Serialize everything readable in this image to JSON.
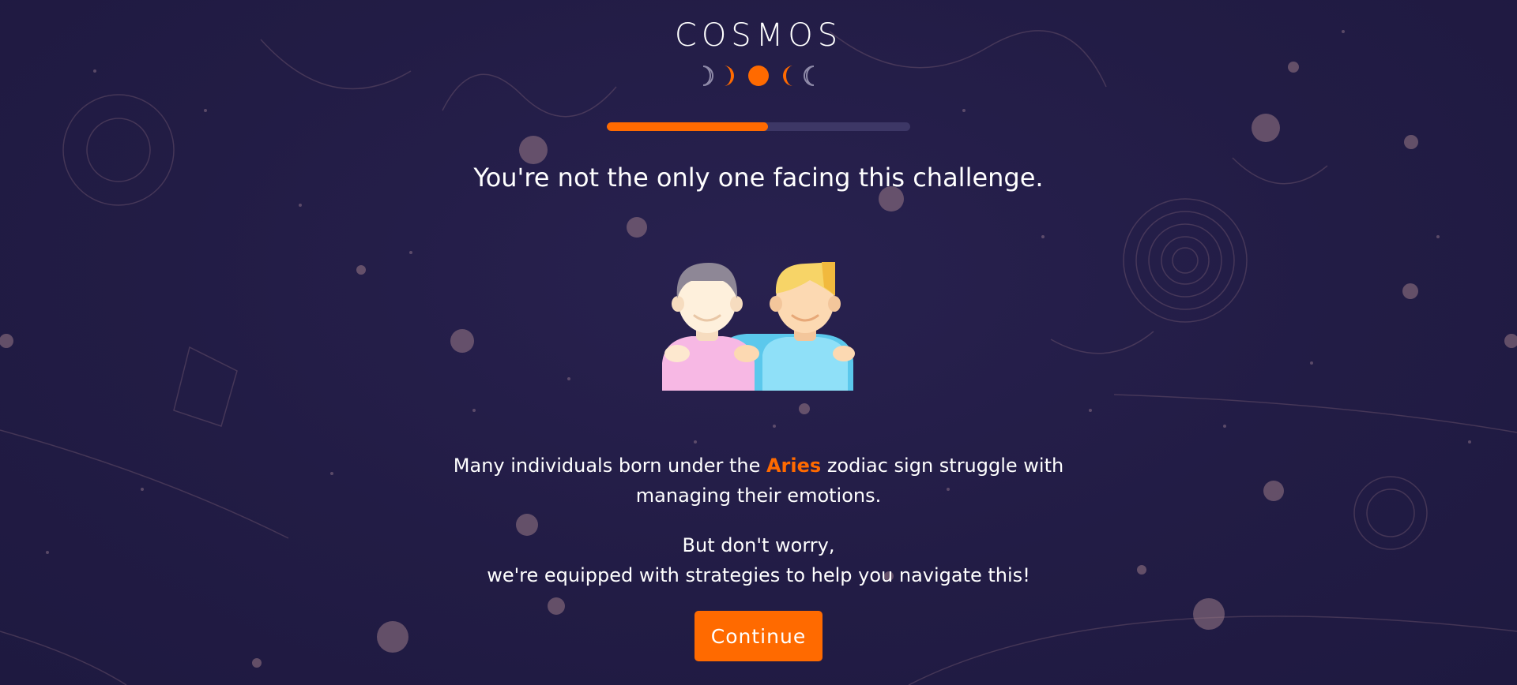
{
  "brand": {
    "name": "COSMOS",
    "moon_icon": "moon-phases-icon",
    "accent_color": "#ff6a00"
  },
  "progress": {
    "fraction": 0.53
  },
  "headline": "You're not the only one facing this challenge.",
  "illustration": {
    "icon": "two-friends-icon"
  },
  "body": {
    "line1_prefix": "Many individuals born under the ",
    "zodiac_sign": "Aries",
    "line1_suffix": " zodiac sign struggle with managing their emotions.",
    "line2_a": "But don't worry,",
    "line2_b": "we're equipped with strategies to help you navigate this!"
  },
  "actions": {
    "continue_label": "Continue"
  },
  "colors": {
    "background": "#221c45",
    "progress_track": "#3d3766",
    "text": "#ffffff"
  }
}
